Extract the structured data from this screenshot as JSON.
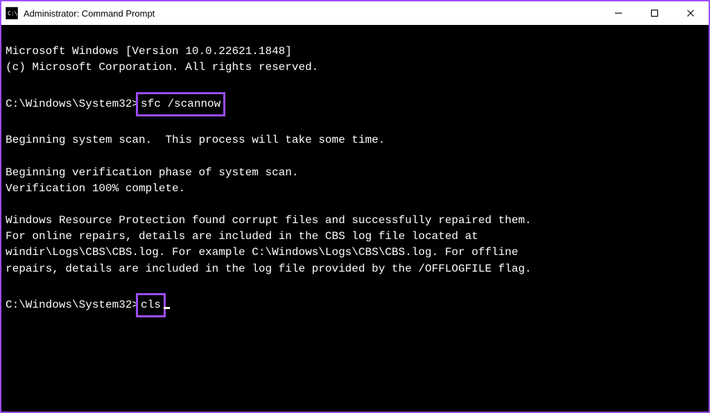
{
  "window": {
    "title": "Administrator: Command Prompt"
  },
  "terminal": {
    "header_line1": "Microsoft Windows [Version 10.0.22621.1848]",
    "header_line2": "(c) Microsoft Corporation. All rights reserved.",
    "prompt1_path": "C:\\Windows\\System32>",
    "prompt1_command": "sfc /scannow",
    "begin_scan": "Beginning system scan.  This process will take some time.",
    "begin_verify": "Beginning verification phase of system scan.",
    "verify_complete": "Verification 100% complete.",
    "result_line1": "Windows Resource Protection found corrupt files and successfully repaired them.",
    "result_line2": "For online repairs, details are included in the CBS log file located at",
    "result_line3": "windir\\Logs\\CBS\\CBS.log. For example C:\\Windows\\Logs\\CBS\\CBS.log. For offline",
    "result_line4": "repairs, details are included in the log file provided by the /OFFLOGFILE flag.",
    "prompt2_path": "C:\\Windows\\System32>",
    "prompt2_command": "cls"
  }
}
